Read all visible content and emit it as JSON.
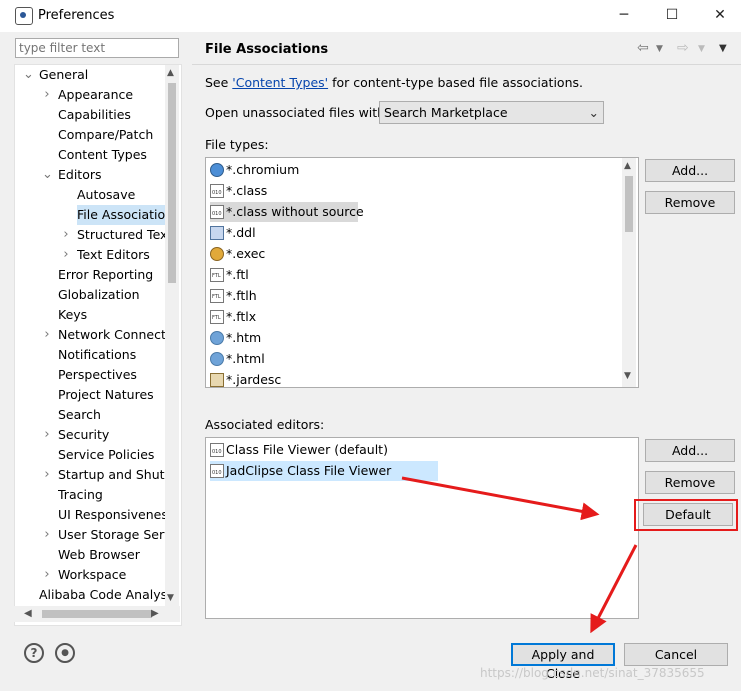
{
  "window": {
    "title": "Preferences",
    "minimize": "─",
    "maximize": "☐",
    "close": "✕"
  },
  "filter": {
    "placeholder": "type filter text"
  },
  "tree": [
    {
      "label": "General",
      "level": 0,
      "twisty": "open"
    },
    {
      "label": "Appearance",
      "level": 1,
      "twisty": "closed"
    },
    {
      "label": "Capabilities",
      "level": 1,
      "twisty": "none"
    },
    {
      "label": "Compare/Patch",
      "level": 1,
      "twisty": "none"
    },
    {
      "label": "Content Types",
      "level": 1,
      "twisty": "none"
    },
    {
      "label": "Editors",
      "level": 1,
      "twisty": "open"
    },
    {
      "label": "Autosave",
      "level": 2,
      "twisty": "none"
    },
    {
      "label": "File Associations",
      "level": 2,
      "twisty": "none",
      "selected": true
    },
    {
      "label": "Structured Text",
      "level": 2,
      "twisty": "closed"
    },
    {
      "label": "Text Editors",
      "level": 2,
      "twisty": "closed"
    },
    {
      "label": "Error Reporting",
      "level": 1,
      "twisty": "none"
    },
    {
      "label": "Globalization",
      "level": 1,
      "twisty": "none"
    },
    {
      "label": "Keys",
      "level": 1,
      "twisty": "none"
    },
    {
      "label": "Network Connections",
      "level": 1,
      "twisty": "closed"
    },
    {
      "label": "Notifications",
      "level": 1,
      "twisty": "none"
    },
    {
      "label": "Perspectives",
      "level": 1,
      "twisty": "none"
    },
    {
      "label": "Project Natures",
      "level": 1,
      "twisty": "none"
    },
    {
      "label": "Search",
      "level": 1,
      "twisty": "none"
    },
    {
      "label": "Security",
      "level": 1,
      "twisty": "closed"
    },
    {
      "label": "Service Policies",
      "level": 1,
      "twisty": "none"
    },
    {
      "label": "Startup and Shutdown",
      "level": 1,
      "twisty": "closed"
    },
    {
      "label": "Tracing",
      "level": 1,
      "twisty": "none"
    },
    {
      "label": "UI Responsiveness",
      "level": 1,
      "twisty": "none"
    },
    {
      "label": "User Storage Service",
      "level": 1,
      "twisty": "closed"
    },
    {
      "label": "Web Browser",
      "level": 1,
      "twisty": "none"
    },
    {
      "label": "Workspace",
      "level": 1,
      "twisty": "closed"
    },
    {
      "label": "Alibaba Code Analysis",
      "level": 0,
      "twisty": "none"
    }
  ],
  "page": {
    "title": "File Associations",
    "see_prefix": "See ",
    "see_link": "'Content Types'",
    "see_suffix": " for content-type based file associations.",
    "open_label": "Open unassociated files with:",
    "open_value": "Search Marketplace",
    "file_types_label": "File types:",
    "assoc_label": "Associated editors:"
  },
  "file_types": [
    {
      "label": "*.chromium",
      "icon": "chrome"
    },
    {
      "label": "*.class",
      "icon": "file"
    },
    {
      "label": "*.class without source",
      "icon": "file",
      "selected": true
    },
    {
      "label": "*.ddl",
      "icon": "db"
    },
    {
      "label": "*.exec",
      "icon": "gear"
    },
    {
      "label": "*.ftl",
      "icon": "ftl"
    },
    {
      "label": "*.ftlh",
      "icon": "ftl"
    },
    {
      "label": "*.ftlx",
      "icon": "ftl"
    },
    {
      "label": "*.htm",
      "icon": "globe"
    },
    {
      "label": "*.html",
      "icon": "globe"
    },
    {
      "label": "*.jardesc",
      "icon": "jar"
    }
  ],
  "editors": [
    {
      "label": "Class File Viewer (default)",
      "icon": "file"
    },
    {
      "label": "JadClipse Class File Viewer",
      "icon": "file",
      "selected": true
    }
  ],
  "buttons": {
    "add1": "Add...",
    "remove1": "Remove",
    "add2": "Add...",
    "remove2": "Remove",
    "default": "Default",
    "apply_close": "Apply and Close",
    "cancel": "Cancel"
  },
  "footer": {
    "help": "?",
    "info": "●"
  },
  "watermark": "https://blog.csdn.net/sinat_37835655",
  "colors": {
    "selection": "#cce4f7",
    "highlight": "#e51b1b",
    "primary": "#0078d7"
  }
}
